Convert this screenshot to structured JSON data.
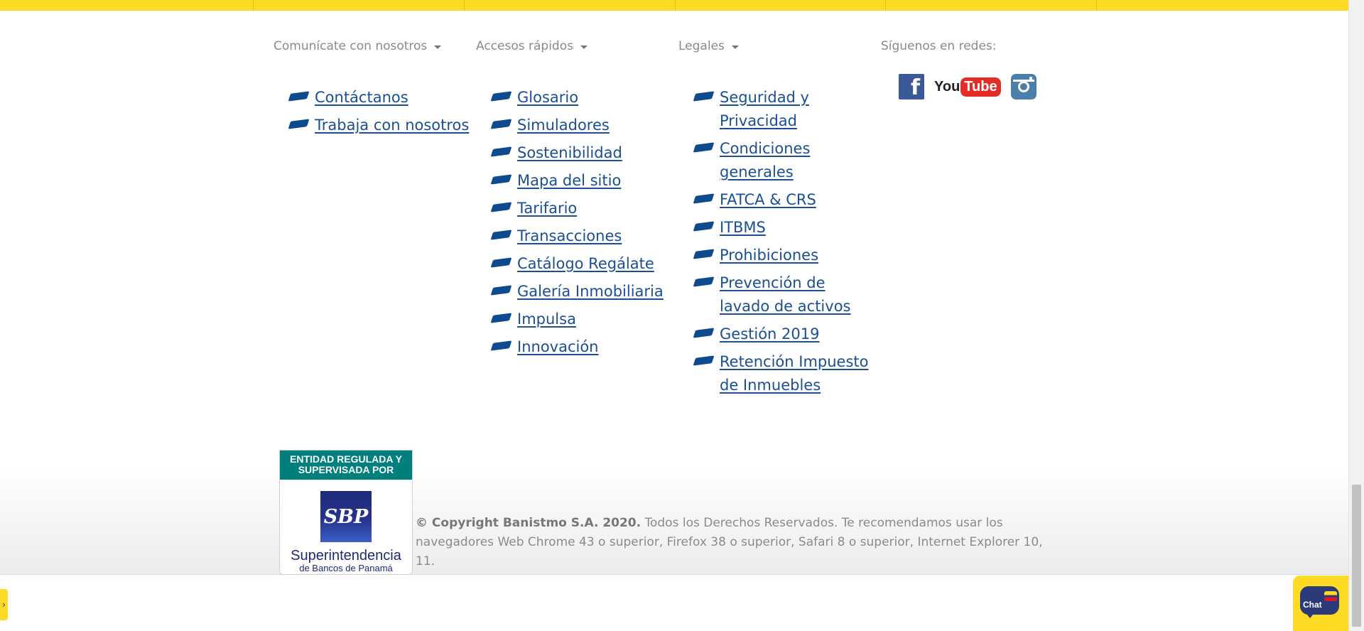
{
  "sections": {
    "contact": {
      "heading": "Comunícate con nosotros",
      "links": [
        "Contáctanos",
        "Trabaja con nosotros"
      ]
    },
    "quick": {
      "heading": "Accesos rápidos",
      "links": [
        "Glosario",
        "Simuladores",
        "Sostenibilidad",
        "Mapa del sitio",
        "Tarifario",
        "Transacciones",
        "Catálogo Regálate",
        "Galería Inmobiliaria",
        "Impulsa",
        "Innovación"
      ]
    },
    "legal": {
      "heading": "Legales",
      "links": [
        "Seguridad y Privacidad",
        "Condiciones generales",
        "FATCA & CRS",
        "ITBMS",
        "Prohibiciones",
        "Prevención de lavado de activos",
        "Gestión 2019",
        "Retención Impuesto de Inmuebles"
      ]
    }
  },
  "social": {
    "heading": "Síguenos en redes:",
    "facebook_label": "f",
    "youtube_you": "You",
    "youtube_tube": "Tube"
  },
  "badge": {
    "header": "ENTIDAD REGULADA Y SUPERVISADA POR",
    "emblem": "SBP",
    "name": "Superintendencia",
    "subname": "de Bancos de Panamá"
  },
  "copyright": {
    "bold": "© Copyright Banistmo S.A. 2020.",
    "text": " Todos los Derechos Reservados. Te recomendamos usar los navegadores Web Chrome 43 o superior, Firefox 38 o superior, Safari 8 o superior, Internet Explorer 10, 11."
  },
  "side_tab": "›",
  "chat": {
    "label": "Chat"
  },
  "colors": {
    "brand_yellow": "#fdda24",
    "link_blue": "#1a4f93",
    "bullet_blue": "#0e4a8e"
  }
}
